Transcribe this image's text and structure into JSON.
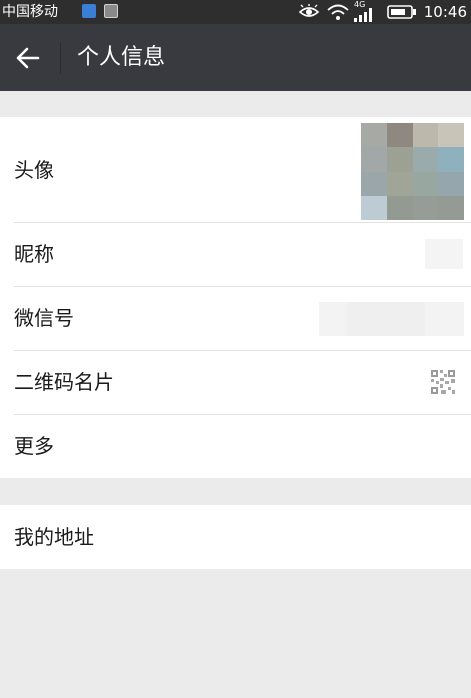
{
  "status_bar": {
    "carrier": "中国移动",
    "network": "4G",
    "time": "10:46",
    "icons": [
      "app-notification-icon",
      "image-notification-icon",
      "eye-icon",
      "wifi-icon",
      "signal-icon",
      "battery-icon"
    ]
  },
  "header": {
    "back_icon": "arrow-left-icon",
    "title": "个人信息"
  },
  "profile": {
    "rows": [
      {
        "label": "头像",
        "value_type": "avatar-image"
      },
      {
        "label": "昵称",
        "value_type": "blurred-text"
      },
      {
        "label": "微信号",
        "value_type": "blurred-text"
      },
      {
        "label": "二维码名片",
        "value_type": "qr-code-icon"
      },
      {
        "label": "更多",
        "value_type": "none"
      }
    ]
  },
  "address": {
    "label": "我的地址"
  },
  "colors": {
    "status_bar_bg": "#2e2e2e",
    "title_bar_bg": "#393a3f",
    "page_bg": "#ebebeb",
    "card_bg": "#ffffff",
    "divider": "#e3e3e3",
    "text": "#1a1a1a"
  },
  "avatar_palette": [
    "#a7a9a5",
    "#8f8880",
    "#bdb8ac",
    "#c8c5b8",
    "#a2a7a8",
    "#9ca193",
    "#9aabab",
    "#8fb0bd",
    "#9aa6aa",
    "#a0a597",
    "#98a79f",
    "#95a7ad",
    "#bccbd4",
    "#939a92",
    "#969d96",
    "#949a94"
  ]
}
